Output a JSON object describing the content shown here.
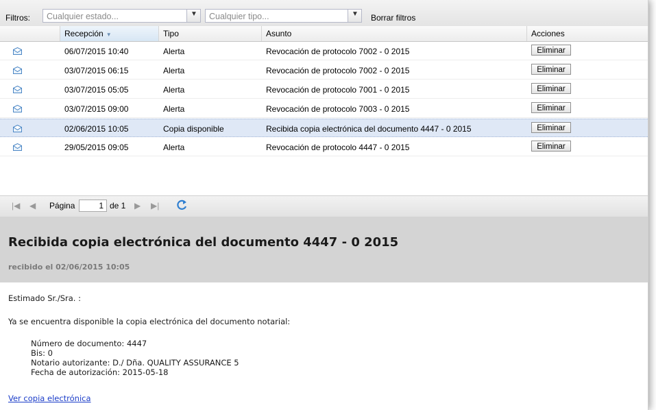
{
  "filters": {
    "label": "Filtros:",
    "estado_placeholder": "Cualquier estado...",
    "tipo_placeholder": "Cualquier tipo...",
    "clear_label": "Borrar filtros"
  },
  "grid": {
    "columns": [
      "Recepción",
      "Tipo",
      "Asunto",
      "Acciones"
    ],
    "rows": [
      {
        "fecha": "06/07/2015 10:40",
        "tipo": "Alerta",
        "asunto": "Revocación de protocolo 7002 - 0 2015",
        "accion": "Eliminar"
      },
      {
        "fecha": "03/07/2015 06:15",
        "tipo": "Alerta",
        "asunto": "Revocación de protocolo 7002 - 0 2015",
        "accion": "Eliminar"
      },
      {
        "fecha": "03/07/2015 05:05",
        "tipo": "Alerta",
        "asunto": "Revocación de protocolo 7001 - 0 2015",
        "accion": "Eliminar"
      },
      {
        "fecha": "03/07/2015 09:00",
        "tipo": "Alerta",
        "asunto": "Revocación de protocolo 7003 - 0 2015",
        "accion": "Eliminar"
      },
      {
        "fecha": "02/06/2015 10:05",
        "tipo": "Copia disponible",
        "asunto": "Recibida copia electrónica del documento 4447 - 0 2015",
        "accion": "Eliminar"
      },
      {
        "fecha": "29/05/2015 09:05",
        "tipo": "Alerta",
        "asunto": "Revocación de protocolo 4447 - 0 2015",
        "accion": "Eliminar"
      }
    ],
    "selected_row": 4
  },
  "pager": {
    "page_label": "Página",
    "page_value": "1",
    "of_label": "de 1"
  },
  "message": {
    "title": "Recibida copia electrónica del documento 4447 - 0 2015",
    "subtitle": "recibido el 02/06/2015 10:05",
    "greeting": "Estimado Sr./Sra. :",
    "intro": "Ya se encuentra disponible la copia electrónica del documento notarial:",
    "details": [
      "Número de documento: 4447",
      "Bis: 0",
      "Notario autorizante: D./ Dña. QUALITY ASSURANCE 5",
      "Fecha de autorización: 2015-05-18"
    ],
    "link_label": "Ver copia electrónica"
  }
}
